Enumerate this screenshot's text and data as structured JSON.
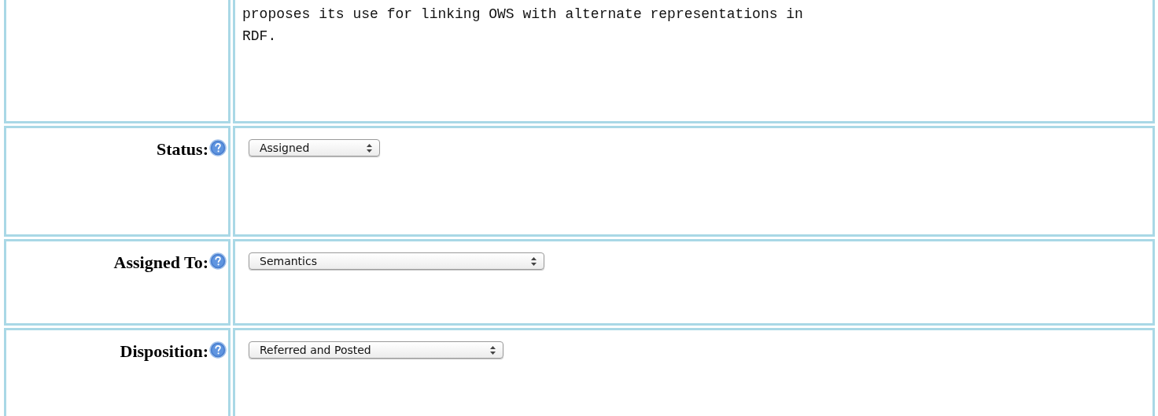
{
  "description": {
    "lines": [
      "proposes its use for linking OWS with alternate representations in",
      "RDF."
    ]
  },
  "fields": [
    {
      "label": "Status:",
      "value": "Assigned"
    },
    {
      "label": "Assigned To:",
      "value": "Semantics"
    },
    {
      "label": "Disposition:",
      "value": "Referred and Posted"
    }
  ]
}
